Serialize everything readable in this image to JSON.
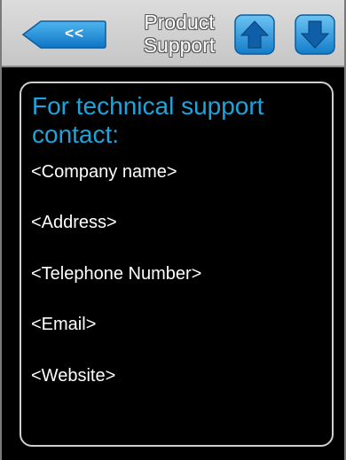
{
  "header": {
    "back_label": "<<",
    "title_line1": "Product",
    "title_line2": "Support"
  },
  "icons": {
    "back": "back-arrow-icon",
    "up": "arrow-up-icon",
    "down": "arrow-down-icon"
  },
  "colors": {
    "accent": "#1ea4dc",
    "button_blue": "#1a8fd8",
    "background": "#000000",
    "header_bg": "#d0d0d0"
  },
  "content": {
    "heading": "For technical support contact:",
    "lines": [
      "<Company name>",
      "<Address>",
      "<Telephone Number>",
      "<Email>",
      "<Website>"
    ]
  }
}
